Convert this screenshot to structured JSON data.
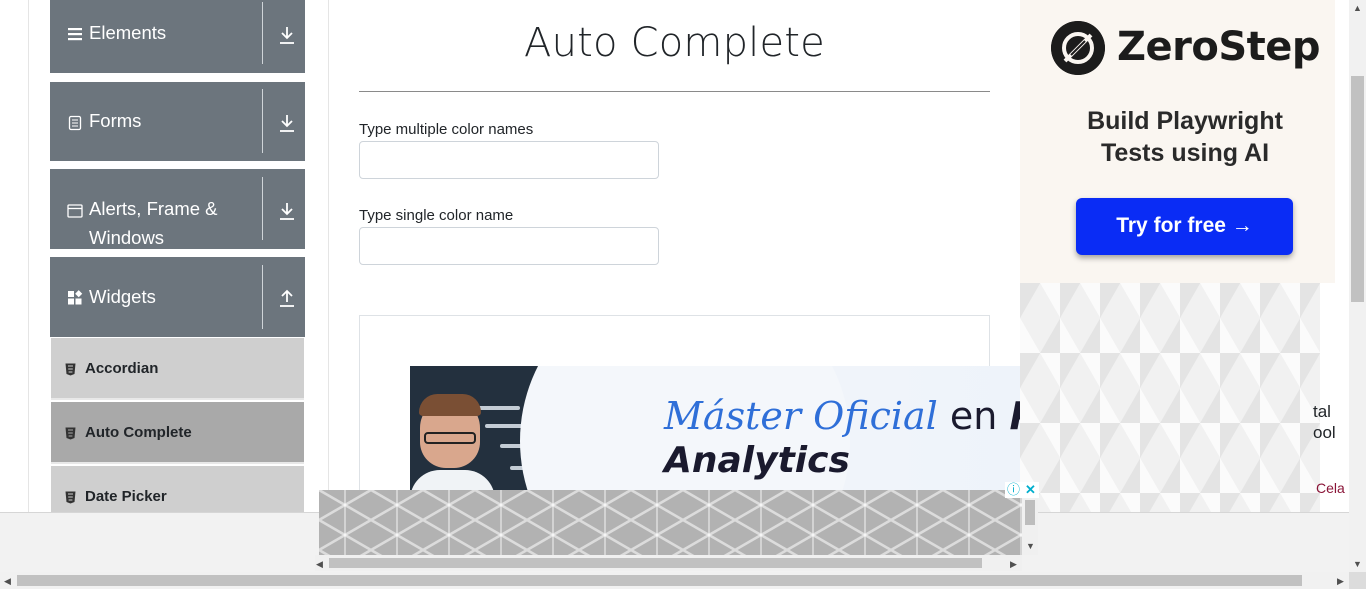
{
  "sidebar": {
    "groups": [
      {
        "label": "Elements",
        "icon": "menu-bars-icon",
        "toggle": "expand-down-icon"
      },
      {
        "label": "Forms",
        "icon": "document-icon",
        "toggle": "expand-down-icon"
      },
      {
        "label_line1": "Alerts, Frame &",
        "label_line2": "Windows",
        "icon": "window-icon",
        "toggle": "expand-down-icon"
      },
      {
        "label": "Widgets",
        "icon": "widgets-grid-icon",
        "toggle": "collapse-up-icon"
      }
    ],
    "items": [
      {
        "label": "Accordian",
        "active": false
      },
      {
        "label": "Auto Complete",
        "active": true
      },
      {
        "label": "Date Picker",
        "active": false
      }
    ],
    "header_color": "#6c757d",
    "item_color": "#cfcfcf",
    "active_item_color": "#a9a9a9"
  },
  "main": {
    "title": "Auto Complete",
    "multiple_label": "Type multiple color names",
    "multiple_value": "",
    "single_label": "Type single color name",
    "single_value": ""
  },
  "inline_ad": {
    "word1": "Máster Oficial",
    "word2": "en",
    "word3": "Pe",
    "line2": "Analytics"
  },
  "right_ad": {
    "brand": "ZeroStep",
    "tagline_line1": "Build Playwright",
    "tagline_line2": "Tests using AI",
    "cta": "Try for free →",
    "cta_color": "#0a2cf5",
    "edge_text_1": "tal",
    "edge_text_2": "ool",
    "edge_link": "Cela"
  },
  "sticky_ad": {
    "info_icon": "ⓘ",
    "close_icon": "✕"
  }
}
